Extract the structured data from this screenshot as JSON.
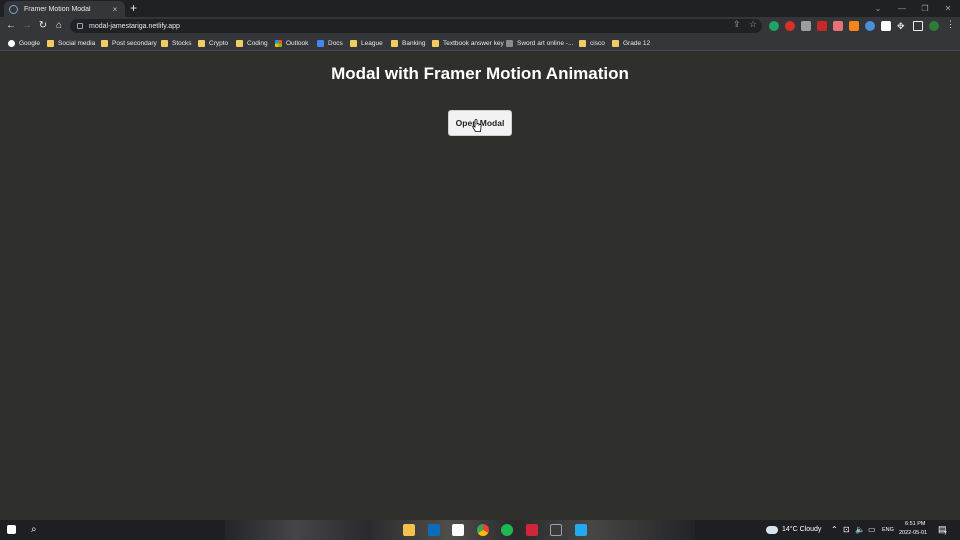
{
  "browser": {
    "tab_title": "Framer Motion Modal",
    "tab_close": "×",
    "new_tab": "+",
    "url": "modal-jamestariga.netlify.app"
  },
  "window_controls": {
    "minimize": "—",
    "maximize": "❐",
    "close": "✕",
    "dropdown": "⌄"
  },
  "nav": {
    "back": "←",
    "forward": "→",
    "reload": "↻",
    "home": "⌂"
  },
  "bookmarks": [
    {
      "label": "Google"
    },
    {
      "label": "Social media"
    },
    {
      "label": "Post secondary"
    },
    {
      "label": "Stocks"
    },
    {
      "label": "Crypto"
    },
    {
      "label": "Coding"
    },
    {
      "label": "Outlook"
    },
    {
      "label": "Docs"
    },
    {
      "label": "League"
    },
    {
      "label": "Banking"
    },
    {
      "label": "Textbook answer key"
    },
    {
      "label": "Sword art online -..."
    },
    {
      "label": "cisco"
    },
    {
      "label": "Grade 12"
    }
  ],
  "page": {
    "title": "Modal with Framer Motion Animation",
    "button_label": "Open Modal"
  },
  "taskbar": {
    "weather": "14°C  Cloudy",
    "lang": "ENG",
    "time": "6:51 PM",
    "date": "2022-05-01",
    "notification_count": "7"
  },
  "colors": {
    "page_bg": "#2f302c",
    "button_bg": "#f2f2f2",
    "folder": "#f2cc60"
  }
}
